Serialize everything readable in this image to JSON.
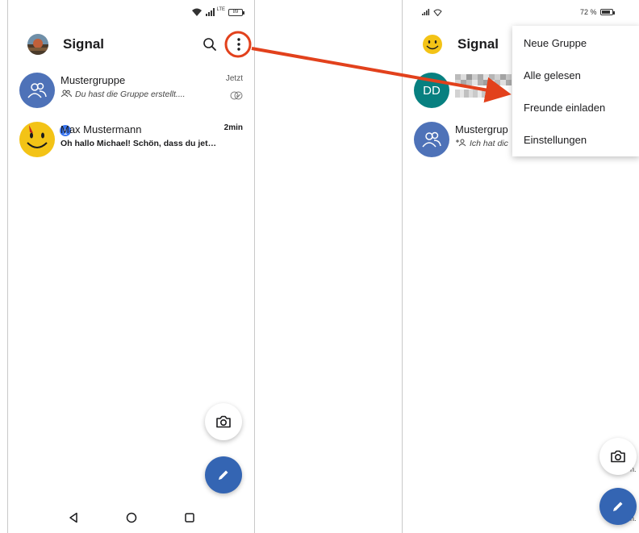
{
  "colors": {
    "annotation": "#e2411c",
    "group_avatar": "#4e72b8",
    "fab_compose": "#3465b3",
    "badge": "#3a76f0",
    "dd_avatar": "#078080"
  },
  "left_phone": {
    "statusbar": {
      "network": "LTE",
      "battery": "89"
    },
    "header": {
      "title": "Signal",
      "search_icon": "search-icon",
      "menu_icon": "more-vertical-icon"
    },
    "conversations": [
      {
        "name": "Mustergruppe",
        "time": "Jetzt",
        "snippet": "Du hast die Gruppe erstellt....",
        "avatar": "group-icon",
        "status_icon": "read-receipt-icon"
      },
      {
        "name": "Max Mustermann",
        "time": "2min",
        "snippet": "Oh hallo Michael! Schön, dass du jet…",
        "avatar": "smiley-icon",
        "badge": "1"
      }
    ],
    "fabs": {
      "camera": "camera-icon",
      "compose": "pencil-icon"
    },
    "navbar": [
      "back-icon",
      "home-icon",
      "recents-icon"
    ]
  },
  "right_phone": {
    "statusbar": {
      "battery_text": "72 %"
    },
    "header": {
      "title": "Signal"
    },
    "conversations": [
      {
        "initials": "DD",
        "snippet_fragment": "r"
      },
      {
        "name": "Mustergrup",
        "snippet": "Ich hat dic"
      }
    ],
    "menu": {
      "items": [
        "Neue Gruppe",
        "Alle gelesen",
        "Freunde einladen",
        "Einstellungen"
      ]
    },
    "edge_text": [
      "n.",
      "n."
    ]
  }
}
